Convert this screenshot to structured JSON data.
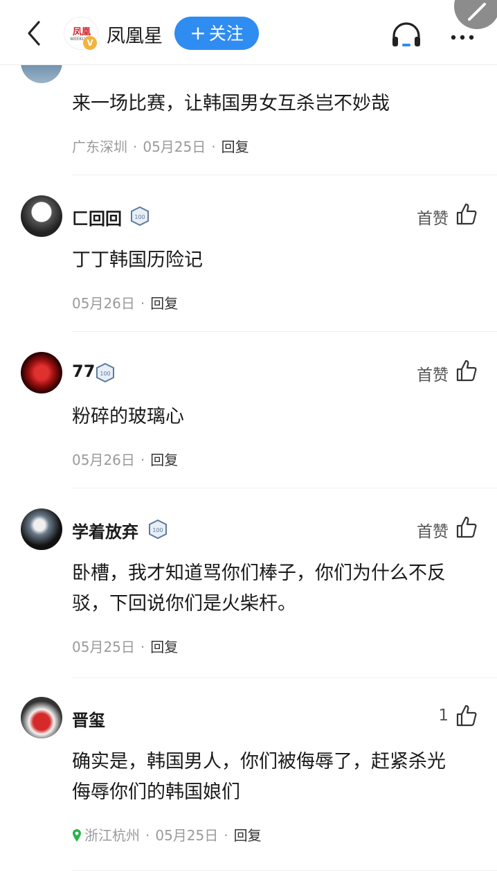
{
  "header": {
    "back_icon": "chevron-left-icon",
    "channel_logo_text": "凤凰",
    "channel_logo_sub": "WEEKLY",
    "verify_badge": "V",
    "channel_name": "凤凰星",
    "follow_plus": "+",
    "follow_label": "关注",
    "listen_icon": "headphones-icon",
    "more_icon": "more-dots-icon"
  },
  "comments": [
    {
      "username": "",
      "text": "来一场比赛，让韩国男女互杀岂不妙哉",
      "location": "广东深圳",
      "date": "05月25日",
      "reply_label": "回复"
    },
    {
      "username": "匚回回",
      "level": "100",
      "like_label": "首赞",
      "text": "丁丁韩国历险记",
      "date": "05月26日",
      "reply_label": "回复"
    },
    {
      "username": "77",
      "level": "100",
      "like_label": "首赞",
      "text": "粉碎的玻璃心",
      "date": "05月26日",
      "reply_label": "回复"
    },
    {
      "username": "学着放弃",
      "level": "100",
      "like_label": "首赞",
      "text_line1": "卧槽，我才知道骂你们棒子，你们为什么不反",
      "text_line2": "驳，下回说你们是火柴杆。",
      "date": "05月25日",
      "reply_label": "回复"
    },
    {
      "username": "晋玺",
      "like_label": "1",
      "text_line1": "确实是，韩国男人，你们被侮辱了，赶紧杀光",
      "text_line2": "侮辱你们的韩国娘们",
      "location": "浙江杭州",
      "date": "05月25日",
      "reply_label": "回复"
    }
  ],
  "colors": {
    "accent": "#2f8cf0",
    "meta_text": "#9a9a9a",
    "location_pin": "#2db34a"
  }
}
